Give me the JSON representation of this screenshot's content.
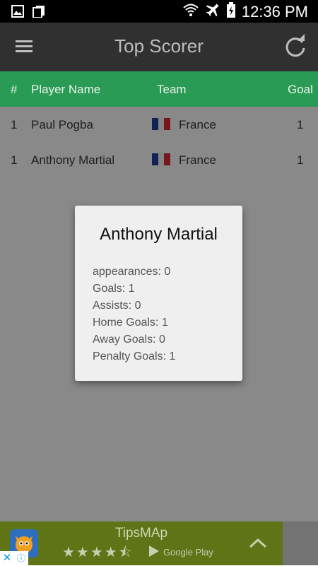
{
  "status_bar": {
    "time": "12:36 PM"
  },
  "app_bar": {
    "title": "Top Scorer"
  },
  "table": {
    "headers": {
      "num": "#",
      "player": "Player Name",
      "team": "Team",
      "goals": "Goal"
    },
    "rows": [
      {
        "num": "1",
        "player": "Paul Pogba",
        "team": "France",
        "goals": "1"
      },
      {
        "num": "1",
        "player": "Anthony Martial",
        "team": "France",
        "goals": "1"
      }
    ]
  },
  "dialog": {
    "title": "Anthony Martial",
    "lines": [
      "appearances: 0",
      "Goals:  1",
      "Assists: 0",
      "Home Goals: 1",
      "Away Goals: 0",
      "Penalty Goals: 1"
    ]
  },
  "ad": {
    "app_name": "TipsMAp",
    "stars": "★★★★⯪",
    "store": "Google Play"
  },
  "colors": {
    "header_green": "#2a9b54",
    "app_bar": "#303030",
    "ad_green": "#5f7417"
  }
}
